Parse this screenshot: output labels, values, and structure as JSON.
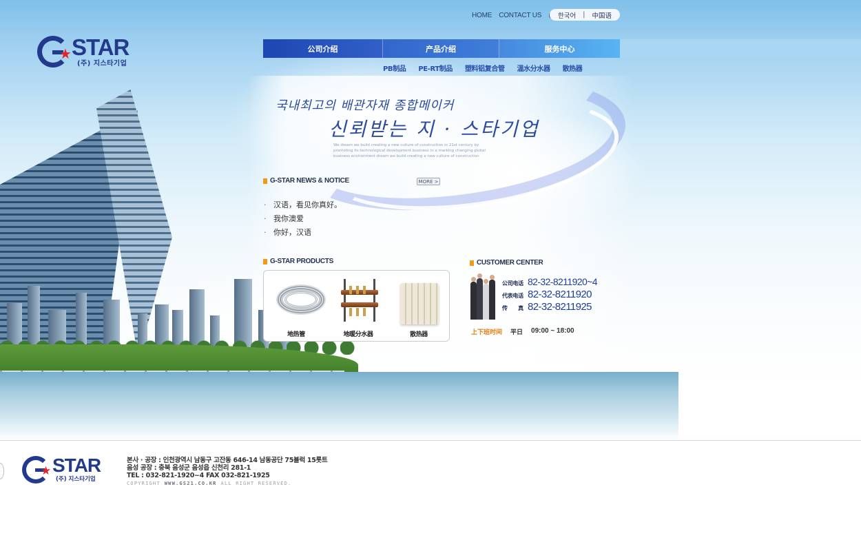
{
  "topnav": {
    "home": "HOME",
    "contact": "CONTACT US",
    "at": "@"
  },
  "lang": {
    "korean": "한국어",
    "sep": "|",
    "chinese": "中国语"
  },
  "logo": {
    "word": "STAR",
    "sub": "(주) 지스타기업"
  },
  "mainnav": {
    "items": [
      "公司介绍",
      "产品介绍",
      "服务中心"
    ]
  },
  "subnav": {
    "items": [
      "PB制品",
      "PE-RT制品",
      "塑料铝复合管",
      "溫水分水器",
      "散热器"
    ]
  },
  "slogan": {
    "line1": "국내최고의 배관자재 종합메이커",
    "line2": "신뢰받는 지 · 스타기업",
    "english": "We dream we build creating a new culture of construction in 21st century by promoting its technological development business in a marking changing global business environment dream we build creating a new culture of construction"
  },
  "news": {
    "title": "G-STAR NEWS & NOTICE",
    "more": "MORE >",
    "items": [
      "汉语，看见你真好。",
      "我你澳爱",
      "你好，汉语"
    ]
  },
  "products": {
    "title": "G-STAR PRODUCTS",
    "items": [
      "地热管",
      "地暖分水器",
      "散热器"
    ]
  },
  "customer": {
    "title": "CUSTOMER CENTER",
    "rows": [
      {
        "key": "公司电话",
        "value": "82-32-8211920~4"
      },
      {
        "key": "代表电话",
        "value": "82-32-8211920"
      },
      {
        "key": "传　　真",
        "value": "82-32-8211925"
      }
    ],
    "hours_label": "上下班时间",
    "hours_day": "平日",
    "hours_time": "09:00 ~ 18:00"
  },
  "footer": {
    "logo_word": "STAR",
    "logo_sub": "(주) 지스타기업",
    "address1": "본사 · 공장 : 인천광역시 남동구 고잔동 646-14 남동공단 75블럭 15롯트",
    "address2": "음성 공장 : 충북 음성군 음성읍 신천리 281-1",
    "phone": "TEL : 032-821-1920~4  FAX 032-821-1925",
    "copy1": "COPYRIGHT",
    "copy_url": "WWW.GS21.CO.KR",
    "copy2": "ALL RIGHT RESERVED."
  },
  "colors": {
    "brand": "#233a8c",
    "accent": "#f29a1b",
    "star": "#e4222b",
    "nav": "#2f5fc6"
  }
}
